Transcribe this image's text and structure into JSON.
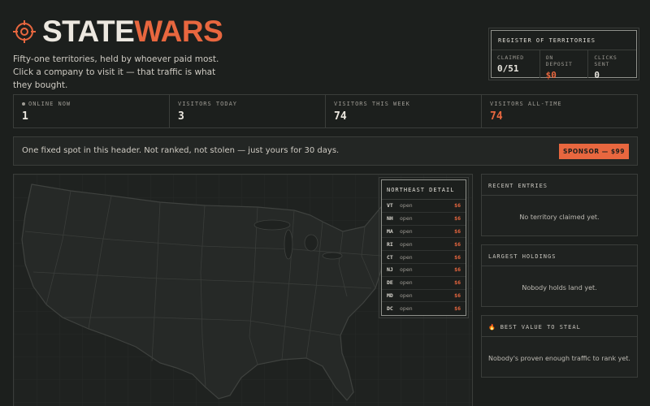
{
  "header": {
    "brand_part1": "STATE",
    "brand_part2": "WARS",
    "tagline": "Fifty-one territories, held by whoever paid most. Click a company to visit it — that traffic is what they bought.",
    "brand_color": "#e8673f",
    "logo_icon": "crosshair-icon"
  },
  "register": {
    "title": "REGISTER OF TERRITORIES",
    "cols": [
      {
        "label": "CLAIMED",
        "value": "0/51"
      },
      {
        "label": "ON DEPOSIT",
        "value": "$0"
      },
      {
        "label": "CLICKS SENT",
        "value": "0"
      }
    ]
  },
  "stats": [
    {
      "label": "ONLINE NOW",
      "value": "1"
    },
    {
      "label": "VISITORS TODAY",
      "value": "3"
    },
    {
      "label": "VISITORS THIS WEEK",
      "value": "74"
    },
    {
      "label": "VISITORS ALL-TIME",
      "value": "74"
    }
  ],
  "sponsor": {
    "text": "One fixed spot in this header. Not ranked, not stolen — just yours for 30 days.",
    "button": "SPONSOR — $99"
  },
  "northeast": {
    "title": "NORTHEAST DETAIL",
    "rows": [
      {
        "code": "VT",
        "status": "open",
        "price": "$6"
      },
      {
        "code": "NH",
        "status": "open",
        "price": "$6"
      },
      {
        "code": "MA",
        "status": "open",
        "price": "$6"
      },
      {
        "code": "RI",
        "status": "open",
        "price": "$6"
      },
      {
        "code": "CT",
        "status": "open",
        "price": "$6"
      },
      {
        "code": "NJ",
        "status": "open",
        "price": "$6"
      },
      {
        "code": "DE",
        "status": "open",
        "price": "$6"
      },
      {
        "code": "MD",
        "status": "open",
        "price": "$6"
      },
      {
        "code": "DC",
        "status": "open",
        "price": "$6"
      }
    ]
  },
  "panels": {
    "recent": {
      "title": "RECENT ENTRIES",
      "body": "No territory claimed yet."
    },
    "largest": {
      "title": "LARGEST HOLDINGS",
      "body": "Nobody holds land yet."
    },
    "steal": {
      "title": "BEST VALUE TO STEAL",
      "body": "Nobody's proven enough traffic to rank yet.",
      "icon": "fire-icon"
    }
  }
}
